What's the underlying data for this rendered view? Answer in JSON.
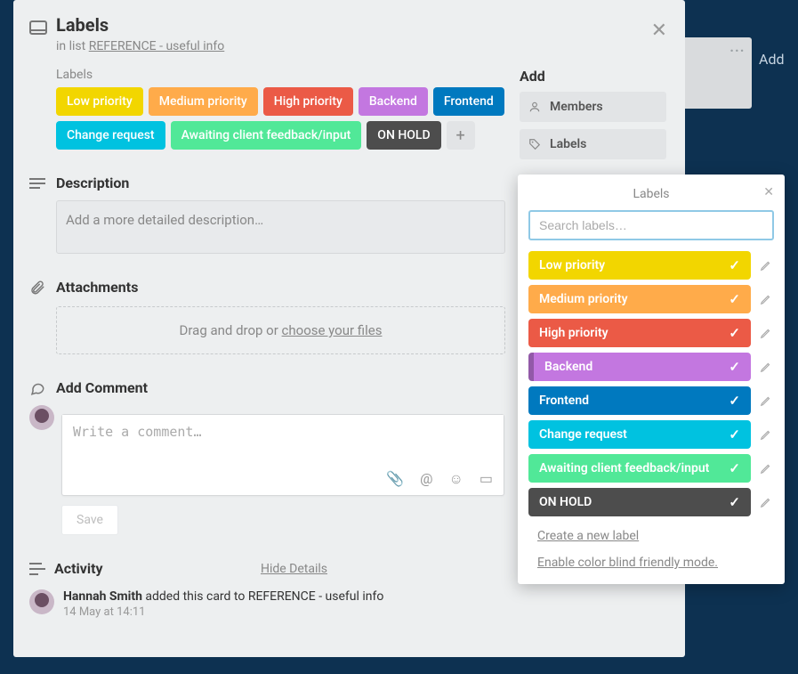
{
  "card": {
    "title": "Labels",
    "inListPrefix": "in list",
    "listName": "REFERENCE - useful info",
    "labelsHeading": "Labels",
    "labels": [
      {
        "name": "Low priority",
        "color": "#f2d600"
      },
      {
        "name": "Medium priority",
        "color": "#ffab4a"
      },
      {
        "name": "High priority",
        "color": "#eb5a46"
      },
      {
        "name": "Backend",
        "color": "#c377e0"
      },
      {
        "name": "Frontend",
        "color": "#0079bf"
      },
      {
        "name": "Change request",
        "color": "#00c2e0"
      },
      {
        "name": "Awaiting client feedback/input",
        "color": "#51e898"
      },
      {
        "name": "ON HOLD",
        "color": "#4d4d4d"
      }
    ],
    "addLabelGlyph": "+"
  },
  "description": {
    "heading": "Description",
    "placeholder": "Add a more detailed description…"
  },
  "attachments": {
    "heading": "Attachments",
    "dropPrefix": "Drag and drop or ",
    "chooseFiles": "choose your files"
  },
  "comment": {
    "heading": "Add Comment",
    "placeholder": "Write a comment…",
    "save": "Save"
  },
  "activity": {
    "heading": "Activity",
    "hideDetails": "Hide Details",
    "items": [
      {
        "author": "Hannah Smith",
        "text": " added this card to REFERENCE - useful info",
        "time": "14 May at 14:11"
      }
    ]
  },
  "sidebar": {
    "heading": "Add",
    "buttons": [
      {
        "label": "Members"
      },
      {
        "label": "Labels"
      }
    ]
  },
  "popover": {
    "title": "Labels",
    "searchPlaceholder": "Search labels…",
    "labels": [
      {
        "name": "Low priority",
        "color": "#f2d600",
        "checked": true
      },
      {
        "name": "Medium priority",
        "color": "#ffab4a",
        "checked": true
      },
      {
        "name": "High priority",
        "color": "#eb5a46",
        "checked": true
      },
      {
        "name": "Backend",
        "color": "#c377e0",
        "checked": true,
        "darkEdge": true
      },
      {
        "name": "Frontend",
        "color": "#0079bf",
        "checked": true
      },
      {
        "name": "Change request",
        "color": "#00c2e0",
        "checked": true
      },
      {
        "name": "Awaiting client feedback/input",
        "color": "#51e898",
        "checked": true
      },
      {
        "name": "ON HOLD",
        "color": "#4d4d4d",
        "checked": true
      }
    ],
    "createLabel": "Create a new label",
    "colorBlind": "Enable color blind friendly mode."
  },
  "boardBg": {
    "menuGlyph": "···",
    "addText": "Add"
  }
}
